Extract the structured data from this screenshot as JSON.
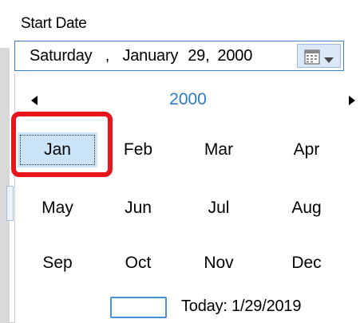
{
  "field": {
    "label": "Start Date"
  },
  "date_input": {
    "weekday": "Saturday",
    "comma1": ",",
    "month": "January",
    "day": "29,",
    "year": "2000"
  },
  "dropdown": {
    "icon": "calendar-icon",
    "arrow": "chevron-down-icon"
  },
  "calendar": {
    "year_title": "2000",
    "prev_icon": "triangle-left-icon",
    "next_icon": "triangle-right-icon",
    "months": [
      "Jan",
      "Feb",
      "Mar",
      "Apr",
      "May",
      "Jun",
      "Jul",
      "Aug",
      "Sep",
      "Oct",
      "Nov",
      "Dec"
    ],
    "selected_month": "Jan",
    "today_label": "Today: 1/29/2019"
  },
  "colors": {
    "accent_blue": "#2f7ac4",
    "selected_fill": "#cce4f7",
    "highlight_ring": "#e8161c"
  }
}
